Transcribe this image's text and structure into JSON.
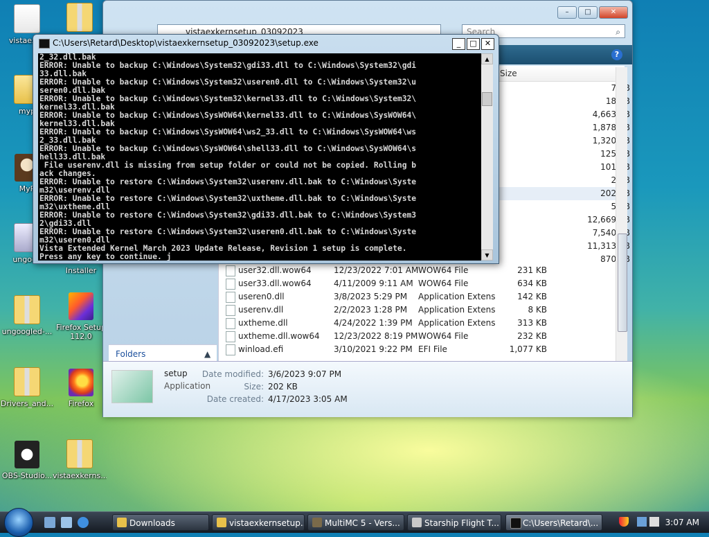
{
  "desktop": {
    "icons": [
      {
        "label": "vistaexke"
      },
      {
        "label": ""
      },
      {
        "label": "myp"
      },
      {
        "label": "MyP"
      },
      {
        "label": "ungoog"
      },
      {
        "label": "Installer"
      },
      {
        "label": "ungoogled-..."
      },
      {
        "label": "Firefox Setup 112.0"
      },
      {
        "label": "Drivers_and..."
      },
      {
        "label": "Firefox"
      },
      {
        "label": "OBS-Studio..."
      },
      {
        "label": "vistaexkerns..."
      }
    ]
  },
  "explorer": {
    "address": "vistaexkernsetup_03092023",
    "search_placeholder": "Search",
    "help_label": "?",
    "column_size": "Size",
    "hidden_sizes": [
      "7 KB",
      "18 KB",
      "4,663 KB",
      "1,878 KB",
      "1,320 KB",
      "125 KB",
      "101 KB",
      "2 KB",
      "202 KB",
      "5 KB",
      "12,669 KB",
      "7,540 KB",
      "11,313 KB",
      "870 KB"
    ],
    "rows": [
      {
        "name": "user32.dll.wow64",
        "date": "12/23/2022 7:01 AM",
        "type": "WOW64 File",
        "size": "231 KB"
      },
      {
        "name": "user33.dll.wow64",
        "date": "4/11/2009 9:11 AM",
        "type": "WOW64 File",
        "size": "634 KB"
      },
      {
        "name": "useren0.dll",
        "date": "3/8/2023 5:29 PM",
        "type": "Application Extens...",
        "size": "142 KB"
      },
      {
        "name": "userenv.dll",
        "date": "2/2/2023 1:28 PM",
        "type": "Application Extens...",
        "size": "8 KB"
      },
      {
        "name": "uxtheme.dll",
        "date": "4/24/2022 1:39 PM",
        "type": "Application Extens...",
        "size": "313 KB"
      },
      {
        "name": "uxtheme.dll.wow64",
        "date": "12/23/2022 8:19 PM",
        "type": "WOW64 File",
        "size": "232 KB"
      },
      {
        "name": "winload.efi",
        "date": "3/10/2021 9:22 PM",
        "type": "EFI File",
        "size": "1,077 KB"
      }
    ],
    "folders_label": "Folders",
    "details": {
      "name": "setup",
      "kind": "Application",
      "modified_label": "Date modified:",
      "modified_value": "3/6/2023 9:07 PM",
      "size_label": "Size:",
      "size_value": "202 KB",
      "created_label": "Date created:",
      "created_value": "4/17/2023 3:05 AM"
    }
  },
  "console": {
    "title": "C:\\Users\\Retard\\Desktop\\vistaexkernsetup_03092023\\setup.exe",
    "lines": [
      "2_32.dll.bak",
      "ERROR: Unable to backup C:\\Windows\\System32\\gdi33.dll to C:\\Windows\\System32\\gdi",
      "33.dll.bak",
      "ERROR: Unable to backup C:\\Windows\\System32\\useren0.dll to C:\\Windows\\System32\\u",
      "seren0.dll.bak",
      "ERROR: Unable to backup C:\\Windows\\System32\\kernel33.dll to C:\\Windows\\System32\\",
      "kernel33.dll.bak",
      "ERROR: Unable to backup C:\\Windows\\SysWOW64\\kernel33.dll to C:\\Windows\\SysWOW64\\",
      "kernel33.dll.bak",
      "ERROR: Unable to backup C:\\Windows\\SysWOW64\\ws2_33.dll to C:\\Windows\\SysWOW64\\ws",
      "2_33.dll.bak",
      "ERROR: Unable to backup C:\\Windows\\SysWOW64\\shell33.dll to C:\\Windows\\SysWOW64\\s",
      "hell33.dll.bak",
      " File userenv.dll is missing from setup folder or could not be copied. Rolling b",
      "ack changes.",
      "ERROR: Unable to restore C:\\Windows\\System32\\userenv.dll.bak to C:\\Windows\\Syste",
      "m32\\userenv.dll",
      "ERROR: Unable to restore C:\\Windows\\System32\\uxtheme.dll.bak to C:\\Windows\\Syste",
      "m32\\uxtheme.dll",
      "ERROR: Unable to restore C:\\Windows\\System32\\gdi33.dll.bak to C:\\Windows\\System3",
      "2\\gdi33.dll",
      "ERROR: Unable to restore C:\\Windows\\System32\\useren0.dll.bak to C:\\Windows\\Syste",
      "m32\\useren0.dll",
      "Vista Extended Kernel March 2023 Update Release, Revision 1 setup is complete.",
      "Press any key to continue. j"
    ]
  },
  "taskbar": {
    "items": [
      {
        "label": "Downloads"
      },
      {
        "label": "vistaexkernsetup..."
      },
      {
        "label": "MultiMC 5 - Vers..."
      },
      {
        "label": "Starship Flight T..."
      },
      {
        "label": "C:\\Users\\Retard\\..."
      }
    ],
    "clock": "3:07 AM"
  }
}
